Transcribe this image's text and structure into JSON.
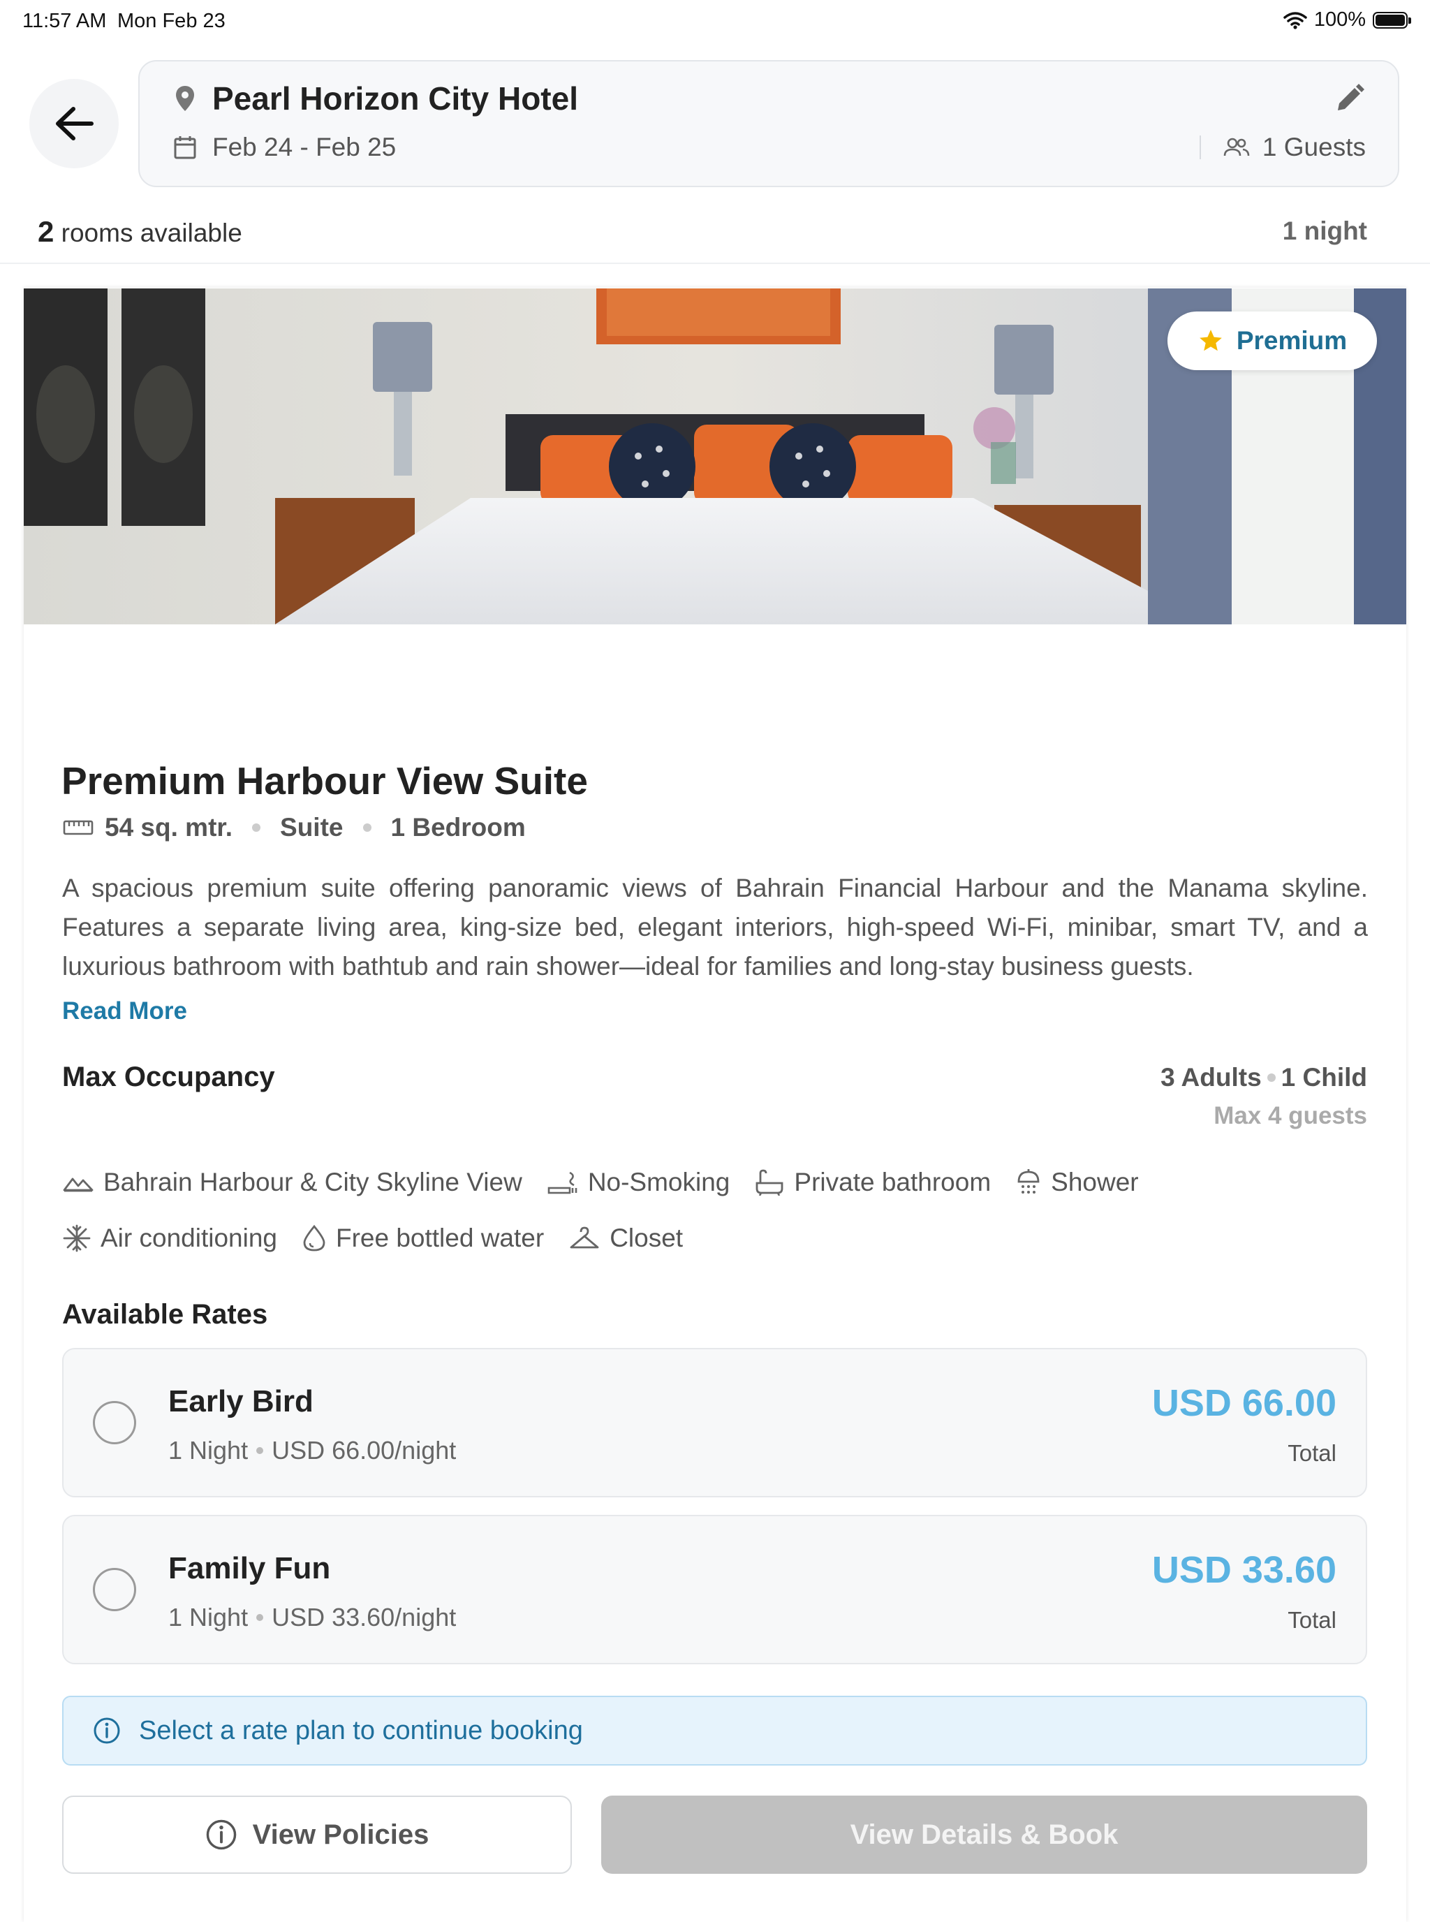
{
  "status_bar": {
    "time": "11:57 AM",
    "date": "Mon Feb 23",
    "battery": "100%"
  },
  "header": {
    "hotel_name": "Pearl Horizon City Hotel",
    "dates": "Feb 24 - Feb 25",
    "guests": "1 Guests"
  },
  "summary": {
    "rooms_count": "2",
    "rooms_label": "rooms available",
    "nights": "1 night"
  },
  "room": {
    "badge": "Premium",
    "title": "Premium Harbour View Suite",
    "size": "54 sq. mtr.",
    "type": "Suite",
    "bedrooms": "1 Bedroom",
    "description": "A spacious premium suite offering panoramic views of Bahrain Financial Harbour and the Manama skyline. Features a separate living area, king-size bed, elegant interiors, high-speed Wi-Fi, minibar, smart TV, and a luxurious bathroom with bathtub and rain shower—ideal for families and long-stay business guests.",
    "read_more": "Read More",
    "occupancy_label": "Max Occupancy",
    "occupancy_adults": "3 Adults",
    "occupancy_children": "1 Child",
    "occupancy_max": "Max 4 guests",
    "amenities": [
      {
        "label": "Bahrain Harbour & City Skyline View",
        "icon": "mountain-view-icon"
      },
      {
        "label": "No-Smoking",
        "icon": "no-smoking-icon"
      },
      {
        "label": "Private bathroom",
        "icon": "bathtub-icon"
      },
      {
        "label": "Shower",
        "icon": "shower-icon"
      },
      {
        "label": "Air conditioning",
        "icon": "snowflake-icon"
      },
      {
        "label": "Free bottled water",
        "icon": "water-drop-icon"
      },
      {
        "label": "Closet",
        "icon": "hanger-icon"
      }
    ]
  },
  "rates": {
    "label": "Available Rates",
    "items": [
      {
        "name": "Early Bird",
        "nights": "1 Night",
        "per_night": "USD 66.00/night",
        "price": "USD 66.00",
        "total_label": "Total",
        "selected": false
      },
      {
        "name": "Family Fun",
        "nights": "1 Night",
        "per_night": "USD 33.60/night",
        "price": "USD 33.60",
        "total_label": "Total",
        "selected": false
      }
    ]
  },
  "info_banner": "Select a rate plan to continue booking",
  "buttons": {
    "policies": "View Policies",
    "book": "View Details & Book"
  },
  "colors": {
    "accent": "#1e7aa6",
    "price": "#5ab3e2",
    "star": "#f5b800",
    "disabled_button": "#c0c0c0"
  }
}
